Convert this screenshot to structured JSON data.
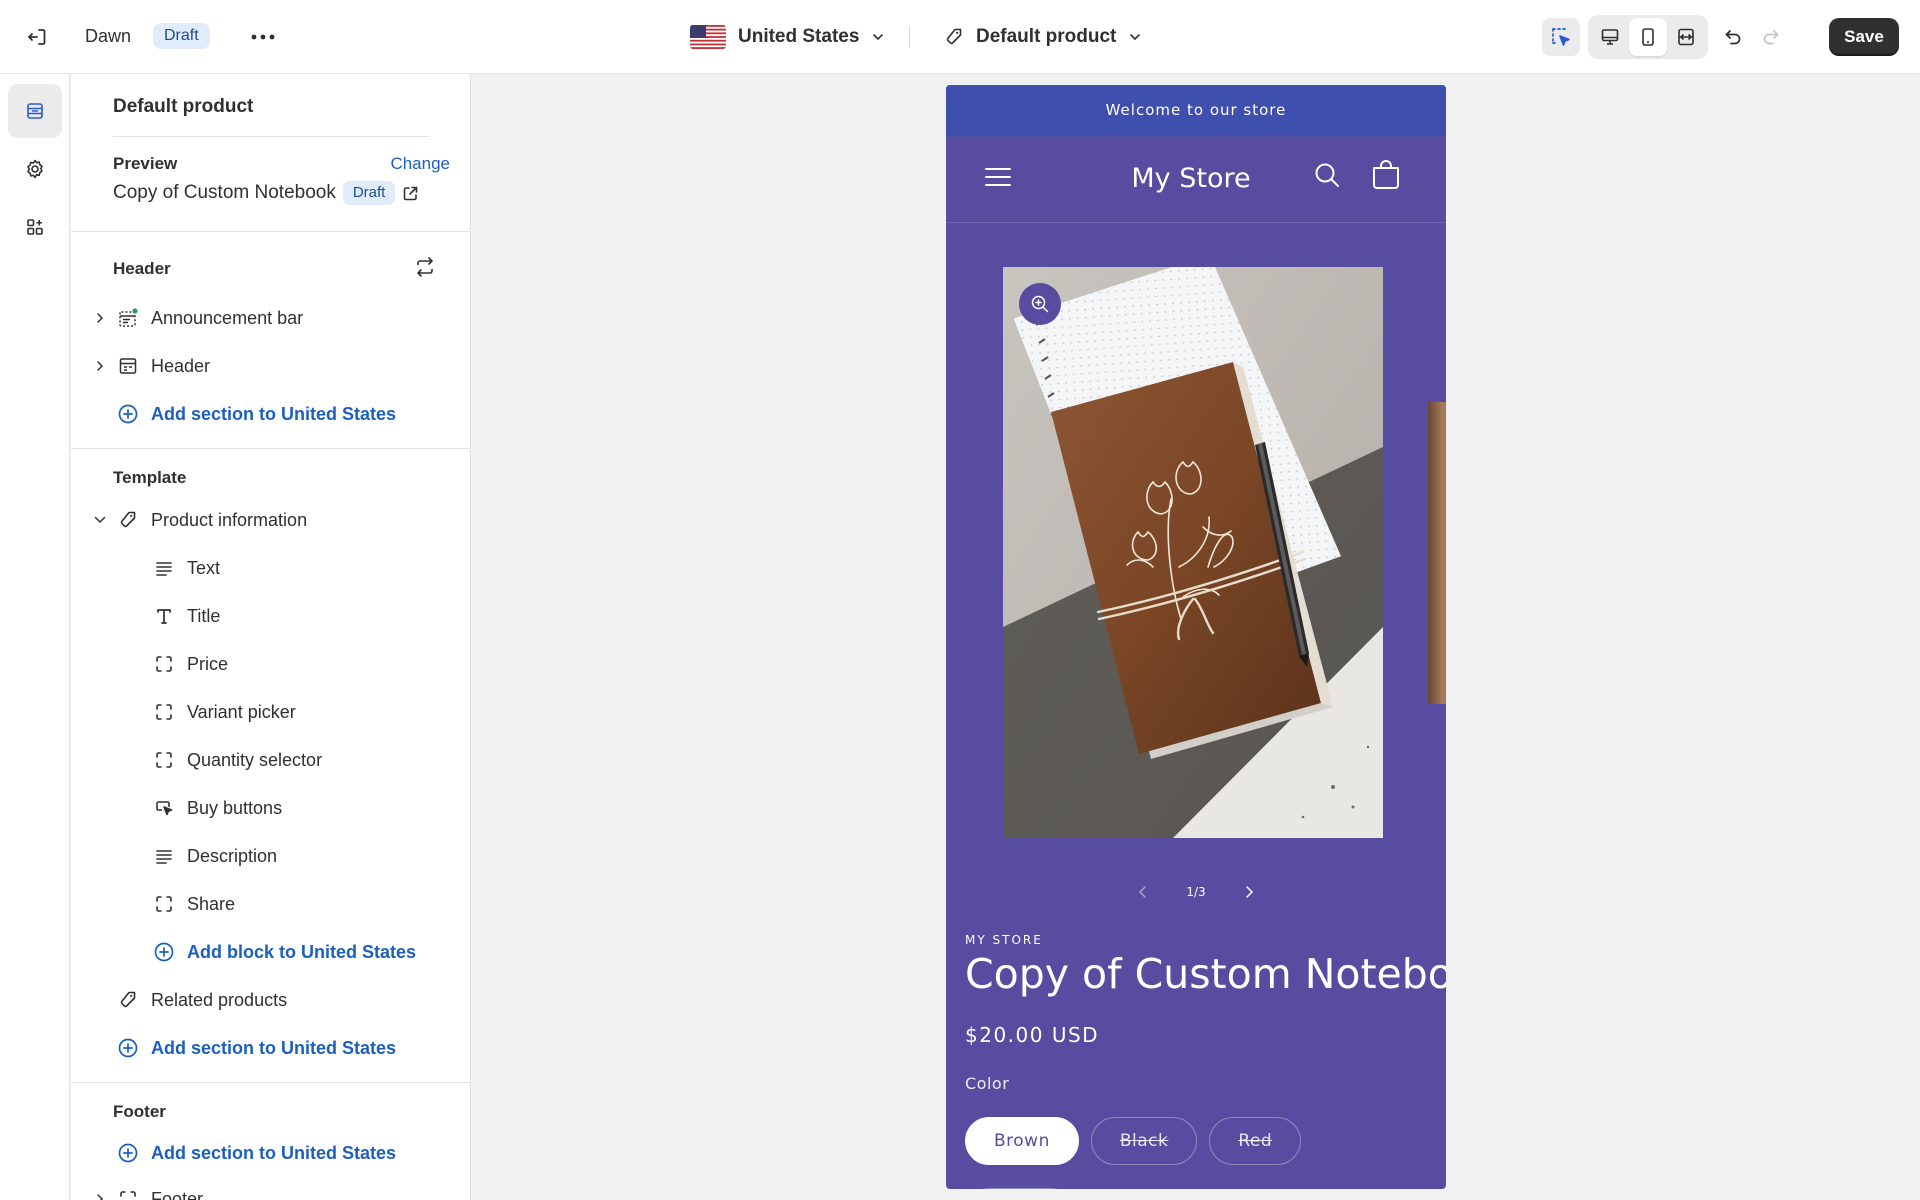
{
  "topbar": {
    "theme_name": "Dawn",
    "theme_status": "Draft",
    "country": "United States",
    "template": "Default product",
    "save_label": "Save"
  },
  "sidebar": {
    "title": "Default product",
    "preview_label": "Preview",
    "change_label": "Change",
    "preview_product": "Copy of Custom Notebook",
    "preview_status": "Draft",
    "header_group": {
      "title": "Header",
      "items": [
        "Announcement bar",
        "Header"
      ],
      "add_label": "Add section to United States"
    },
    "template_group": {
      "title": "Template",
      "section": "Product information",
      "blocks": [
        "Text",
        "Title",
        "Price",
        "Variant picker",
        "Quantity selector",
        "Buy buttons",
        "Description",
        "Share"
      ],
      "add_block_label": "Add block to United States",
      "related": "Related products",
      "add_label": "Add section to United States"
    },
    "footer_group": {
      "title": "Footer",
      "add_label": "Add section to United States",
      "item": "Footer"
    }
  },
  "preview": {
    "announcement": "Welcome to our store",
    "store_name": "My Store",
    "pager": "1/3",
    "vendor": "MY STORE",
    "product_title": "Copy of Custom Notebook",
    "price": "$20.00 USD",
    "color_label": "Color",
    "colors": [
      "Brown",
      "Black",
      "Red"
    ],
    "selected_color": "Brown",
    "bg_color": "#574c9f",
    "announcement_color": "#3f4fae"
  },
  "icons": {
    "exit": "exit-icon",
    "more": "more-icon",
    "tag": "tag-icon",
    "inspector": "inspector-icon",
    "desktop": "desktop-icon",
    "mobile": "mobile-icon",
    "fullwidth": "full-width-icon",
    "undo": "undo-icon",
    "redo": "redo-icon"
  }
}
